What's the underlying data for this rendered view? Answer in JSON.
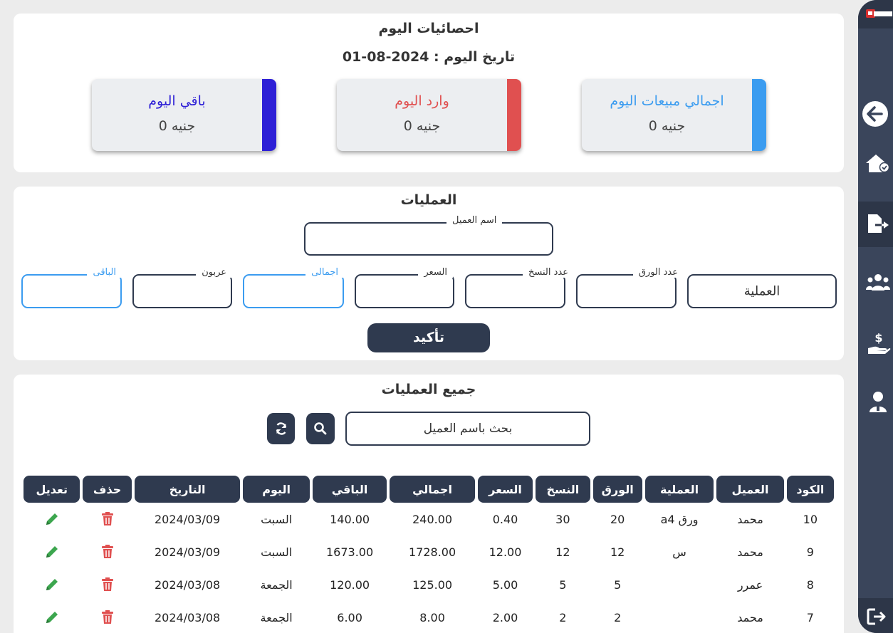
{
  "stats": {
    "title": "احصائيات اليوم",
    "date_line": "تاريخ اليوم : 2024-08-01",
    "cards": [
      {
        "label": "اجمالي مبيعات اليوم",
        "value": "0 جنيه",
        "color": "#3b9cf0"
      },
      {
        "label": "وارد اليوم",
        "value": "0 جنيه",
        "color": "#e05050"
      },
      {
        "label": "باقي اليوم",
        "value": "0 جنيه",
        "color": "#2d1fd6"
      }
    ]
  },
  "operations": {
    "title": "العمليات",
    "customer_label": "اسم العميل",
    "operation_placeholder": "العملية",
    "paper_count_label": "عدد الورق",
    "copies_label": "عدد النسخ",
    "price_label": "السعر",
    "total_label": "اجمالى",
    "deposit_label": "عربون",
    "remaining_label": "الباقى",
    "confirm_label": "تأكيد"
  },
  "all_operations": {
    "title": "جميع العمليات",
    "search_placeholder": "بحث باسم العميل",
    "headers": [
      "الكود",
      "العميل",
      "العملية",
      "الورق",
      "النسخ",
      "السعر",
      "اجمالي",
      "الباقي",
      "اليوم",
      "التاريخ",
      "حذف",
      "تعديل"
    ],
    "rows": [
      {
        "code": "10",
        "customer": "محمد",
        "operation": "ورق a4",
        "paper": "20",
        "copies": "30",
        "price": "0.40",
        "total": "240.00",
        "remaining": "140.00",
        "day": "السبت",
        "date": "2024/03/09"
      },
      {
        "code": "9",
        "customer": "محمد",
        "operation": "س",
        "paper": "12",
        "copies": "12",
        "price": "12.00",
        "total": "1728.00",
        "remaining": "1673.00",
        "day": "السبت",
        "date": "2024/03/09"
      },
      {
        "code": "8",
        "customer": "عمرر",
        "operation": "",
        "paper": "5",
        "copies": "5",
        "price": "5.00",
        "total": "125.00",
        "remaining": "120.00",
        "day": "الجمعة",
        "date": "2024/03/08"
      },
      {
        "code": "7",
        "customer": "محمد",
        "operation": "",
        "paper": "2",
        "copies": "2",
        "price": "2.00",
        "total": "8.00",
        "remaining": "6.00",
        "day": "الجمعة",
        "date": "2024/03/08"
      }
    ]
  },
  "sidebar": {
    "icons": [
      "logo-icon",
      "back-arrow-icon",
      "home-icon",
      "file-export-icon",
      "users-icon",
      "hand-money-icon",
      "user-icon",
      "logout-icon"
    ]
  }
}
